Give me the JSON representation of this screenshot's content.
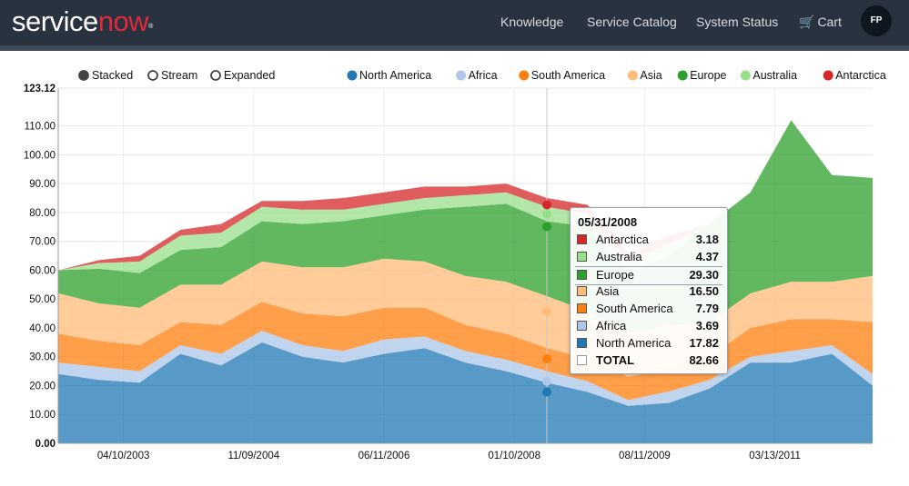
{
  "brand": {
    "logo_part1": "service",
    "logo_part2": "now",
    "logo_tm": "®"
  },
  "nav": {
    "items": [
      {
        "label": "Knowledge"
      },
      {
        "label": "Service Catalog"
      },
      {
        "label": "System Status"
      }
    ],
    "cart_label": "Cart",
    "avatar_initials": "FP"
  },
  "colors": {
    "navbar_bg": "#293340",
    "brand_accent": "#e0293b",
    "North America": "#1f77b4",
    "Africa": "#aec7e8",
    "South America": "#ff7f0e",
    "Asia": "#ffbb78",
    "Europe": "#2ca02c",
    "Australia": "#98df8a",
    "Antarctica": "#d62728"
  },
  "controls": {
    "styles": [
      {
        "label": "Stacked",
        "selected": true
      },
      {
        "label": "Stream",
        "selected": false
      },
      {
        "label": "Expanded",
        "selected": false
      }
    ]
  },
  "chart_data": {
    "type": "area",
    "stacked": true,
    "grid": true,
    "legend_position": "top-right",
    "ylim": [
      0,
      123.12
    ],
    "y_ticks": [
      "0.00",
      "10.00",
      "20.00",
      "30.00",
      "40.00",
      "50.00",
      "60.00",
      "70.00",
      "80.00",
      "90.00",
      "100.00",
      "110.00",
      "123.12"
    ],
    "x_ticks": [
      "04/10/2003",
      "11/09/2004",
      "06/11/2006",
      "01/10/2008",
      "08/11/2009",
      "03/13/2011"
    ],
    "x": [
      "01/2002",
      "07/2002",
      "01/2003",
      "07/2003",
      "01/2004",
      "07/2004",
      "01/2005",
      "07/2005",
      "01/2006",
      "07/2006",
      "01/2007",
      "07/2007",
      "01/2008",
      "07/2008",
      "01/2009",
      "07/2009",
      "01/2010",
      "07/2010",
      "01/2011",
      "07/2011",
      "01/2012"
    ],
    "series": [
      {
        "name": "North America",
        "values": [
          24,
          22,
          21,
          31,
          27,
          35,
          30,
          28,
          31,
          33,
          28,
          25,
          21,
          17.8,
          13,
          14,
          19,
          28,
          28,
          31,
          20
        ]
      },
      {
        "name": "Africa",
        "values": [
          4,
          4.5,
          4,
          3,
          4,
          4,
          4,
          4,
          5,
          4,
          4,
          4,
          4,
          3.7,
          2,
          4,
          3,
          2,
          4,
          3,
          4
        ]
      },
      {
        "name": "South America",
        "values": [
          10,
          9,
          9,
          8,
          10,
          10,
          11,
          12,
          11,
          10,
          9,
          9,
          8,
          7.8,
          8,
          8,
          8,
          10,
          11,
          9,
          18
        ]
      },
      {
        "name": "Asia",
        "values": [
          14,
          13,
          13,
          13,
          14,
          14,
          16,
          17,
          17,
          16,
          17,
          18,
          18,
          16.5,
          15,
          15,
          12,
          12,
          13,
          13,
          16
        ]
      },
      {
        "name": "Europe",
        "values": [
          8,
          12,
          12,
          12,
          13,
          14,
          15,
          16,
          15,
          18,
          24,
          27,
          26,
          29.3,
          21,
          24,
          34,
          35,
          56,
          37,
          34
        ]
      },
      {
        "name": "Australia",
        "values": [
          0,
          2,
          4,
          5,
          5,
          5,
          5,
          4,
          4,
          4,
          4,
          4,
          5,
          4.37,
          4,
          4,
          0,
          0,
          0,
          0,
          0
        ]
      },
      {
        "name": "Antarctica",
        "values": [
          0,
          1,
          2,
          2,
          3,
          2,
          3,
          4,
          4,
          4,
          3,
          3,
          3,
          3.18,
          3,
          3,
          0,
          0,
          0,
          0,
          0
        ]
      }
    ]
  },
  "tooltip": {
    "date": "05/31/2008",
    "rows": [
      {
        "name": "Antarctica",
        "value": "3.18",
        "color": "#d62728"
      },
      {
        "name": "Australia",
        "value": "4.37",
        "color": "#98df8a"
      },
      {
        "name": "Europe",
        "value": "29.30",
        "color": "#2ca02c"
      },
      {
        "name": "Asia",
        "value": "16.50",
        "color": "#ffbb78"
      },
      {
        "name": "South America",
        "value": "7.79",
        "color": "#ff7f0e"
      },
      {
        "name": "Africa",
        "value": "3.69",
        "color": "#aec7e8"
      },
      {
        "name": "North America",
        "value": "17.82",
        "color": "#1f77b4"
      }
    ],
    "total_label": "TOTAL",
    "total_value": "82.66"
  }
}
